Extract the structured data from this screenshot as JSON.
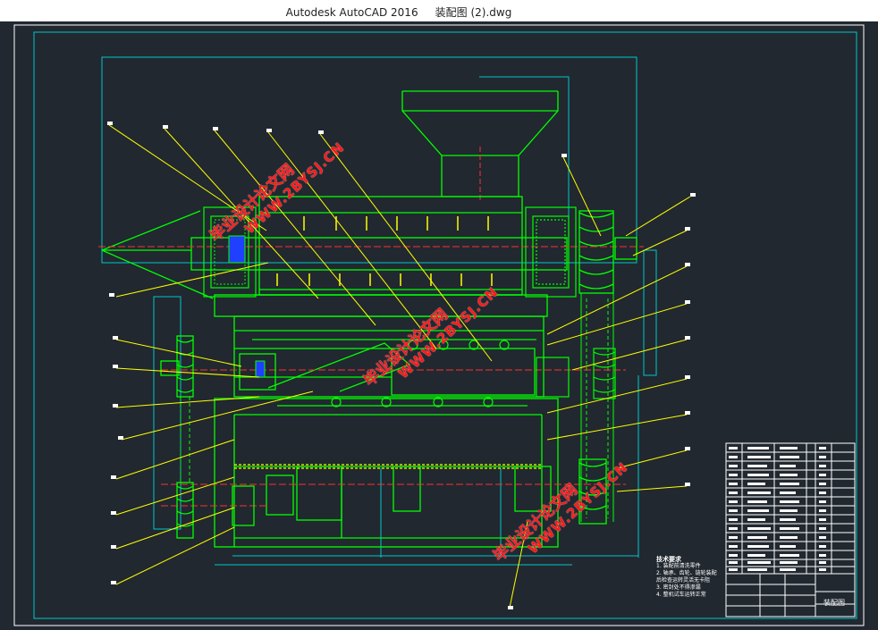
{
  "app": {
    "name": "Autodesk AutoCAD 2016",
    "file": "装配图 (2).dwg"
  },
  "watermarks": [
    {
      "cn": "毕业设计论文网",
      "url": "WWW.2BYSJ.CN"
    },
    {
      "cn": "毕业设计论文网",
      "url": "WWW.2BYSJ.CN"
    },
    {
      "cn": "毕业设计论文网",
      "url": "WWW.2BYSJ.CN"
    }
  ],
  "drawing": {
    "tech_notes_title": "技术要求",
    "tech_notes": [
      "1. 装配前清洗零件",
      "2. 轴承、齿轮、链轮装配",
      "后检查运转灵活无卡阻",
      "3. 密封处不得渗漏",
      "4. 整机试车运转正常"
    ],
    "titleblock_name": "装配图"
  },
  "colors": {
    "background": "#212830",
    "green": "#00ff00",
    "cyan": "#00c8c8",
    "yellow": "#ffff00",
    "red": "#ff3030",
    "white": "#ffffff",
    "blue": "#2040ff"
  }
}
